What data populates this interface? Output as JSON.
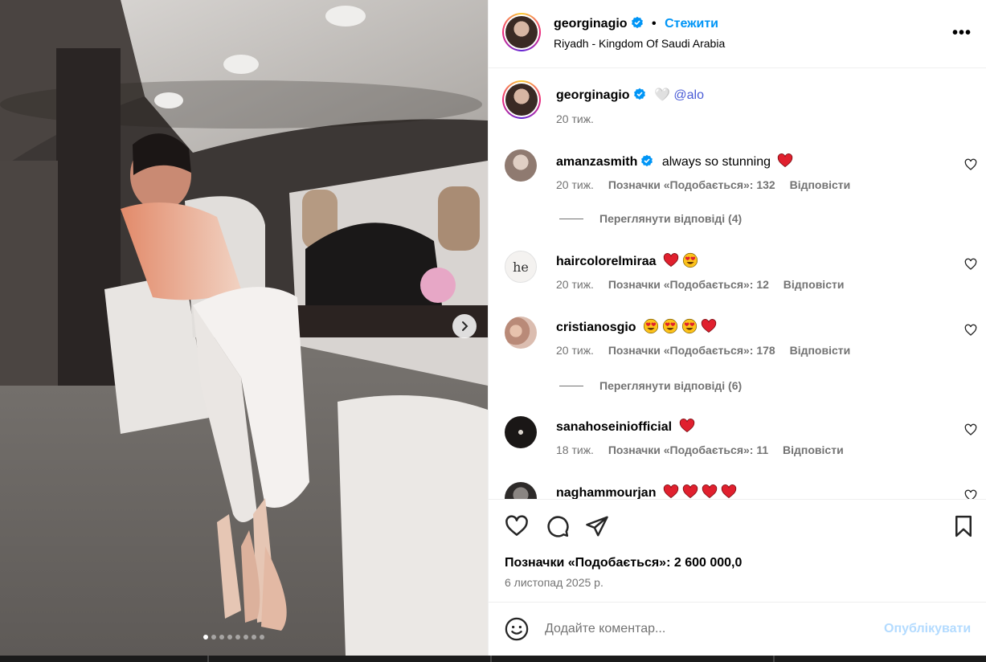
{
  "post": {
    "username": "georginagio",
    "follow_label": "Стежити",
    "location": "Riyadh - Kingdom Of Saudi Arabia",
    "more_icon": "more-options-icon",
    "caption_glyph": "🤍",
    "caption_mention": "@alo",
    "caption_age": "20 тиж."
  },
  "comments": [
    {
      "username": "amanzasmith",
      "verified": true,
      "text": "always so stunning",
      "emojis": [
        "heart"
      ],
      "age": "20 тиж.",
      "likes": "Позначки «Подобається»: 132",
      "reply": "Відповісти",
      "view_replies": "Переглянути відповіді (4)"
    },
    {
      "username": "haircolorelmiraa",
      "verified": false,
      "text": "",
      "emojis": [
        "heart",
        "heart-eyes"
      ],
      "age": "20 тиж.",
      "likes": "Позначки «Подобається»: 12",
      "reply": "Відповісти",
      "view_replies": ""
    },
    {
      "username": "cristianosgio",
      "verified": false,
      "text": "",
      "emojis": [
        "heart-eyes",
        "heart-eyes",
        "heart-eyes",
        "heart"
      ],
      "age": "20 тиж.",
      "likes": "Позначки «Подобається»: 178",
      "reply": "Відповісти",
      "view_replies": "Переглянути відповіді (6)"
    },
    {
      "username": "sanahoseiniofficial",
      "verified": false,
      "text": "",
      "emojis": [
        "heart"
      ],
      "age": "18 тиж.",
      "likes": "Позначки «Подобається»: 11",
      "reply": "Відповісти",
      "view_replies": ""
    },
    {
      "username": "naghammourjan",
      "verified": false,
      "text": "",
      "emojis": [
        "heart",
        "heart",
        "heart",
        "heart"
      ],
      "age": "",
      "likes": "",
      "reply": "",
      "view_replies": ""
    }
  ],
  "actions": {
    "likes": "Позначки «Подобається»: 2 600 000,0",
    "date": "6 листопад 2025 р."
  },
  "composer": {
    "placeholder": "Додайте коментар...",
    "publish_label": "Опублікувати"
  },
  "carousel": {
    "slides": 8,
    "active_index": 0
  },
  "colors": {
    "link": "#0095f6",
    "publish_disabled": "#b3dbff",
    "muted": "#737373",
    "heart": "#ff3040",
    "mention": "#4a5cd6"
  }
}
